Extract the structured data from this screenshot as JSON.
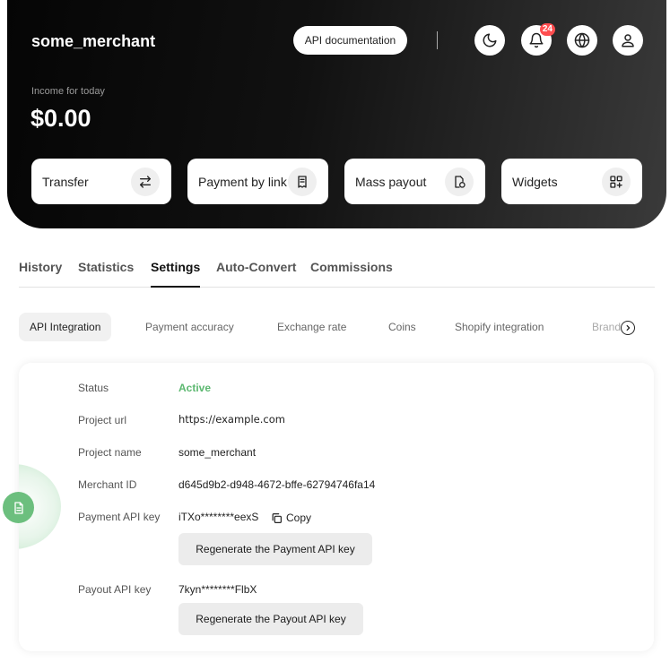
{
  "header": {
    "merchant_name": "some_merchant",
    "api_doc_label": "API documentation",
    "notifications_count": "24",
    "income_label": "Income for today",
    "income_value": "$0.00"
  },
  "actions": [
    {
      "label": "Transfer",
      "icon": "transfer-arrows-icon"
    },
    {
      "label": "Payment by link",
      "icon": "receipt-icon"
    },
    {
      "label": "Mass payout",
      "icon": "payout-icon"
    },
    {
      "label": "Widgets",
      "icon": "widgets-grid-icon"
    }
  ],
  "tabs": [
    "History",
    "Statistics",
    "Settings",
    "Auto-Convert",
    "Commissions"
  ],
  "active_tab": "Settings",
  "subtabs": [
    "API Integration",
    "Payment accuracy",
    "Exchange rate",
    "Coins",
    "Shopify integration",
    "Brand"
  ],
  "settings": {
    "status_label": "Status",
    "status_value": "Active",
    "project_url_label": "Project url",
    "project_url_value": "https://example.com",
    "project_name_label": "Project name",
    "project_name_value": "some_merchant",
    "merchant_id_label": "Merchant ID",
    "merchant_id_value": "d645d9b2-d948-4672-bffe-62794746fa14",
    "payment_key_label": "Payment API key",
    "payment_key_value": "iTXo********eexS",
    "copy_label": "Copy",
    "regen_payment_label": "Regenerate the Payment API key",
    "payout_key_label": "Payout API key",
    "payout_key_value": "7kyn********FlbX",
    "regen_payout_label": "Regenerate the Payout API key"
  },
  "colors": {
    "accent_green": "#5cb870",
    "badge_red": "#ff4d4f",
    "hero_dark": "#050505"
  }
}
